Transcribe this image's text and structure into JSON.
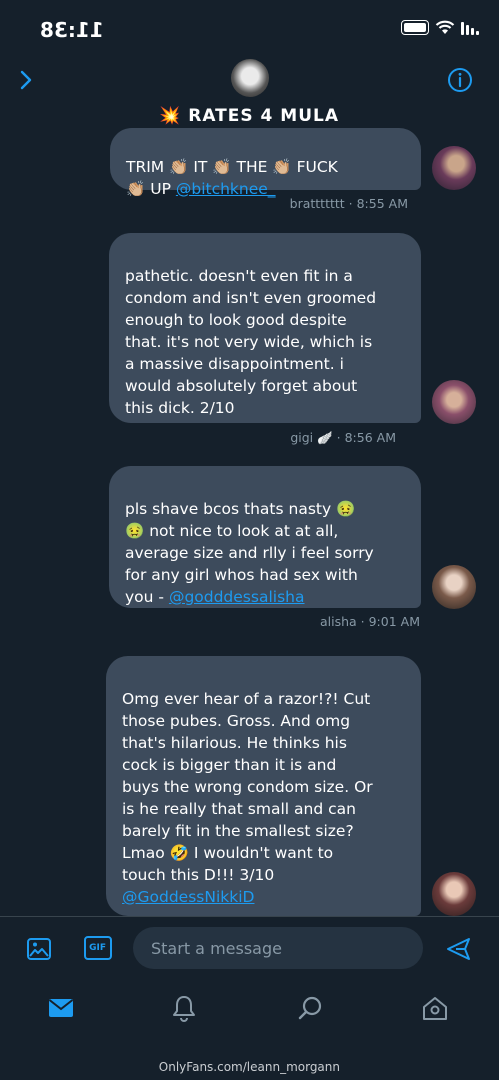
{
  "status_bar": {
    "time": "11:38"
  },
  "header": {
    "title": "💥 RATES 4 MULA"
  },
  "messages": [
    {
      "text_lines": [
        "TRIM 👏🏼 IT 👏🏼 THE 👏🏼 FUCK",
        "👏🏼 UP "
      ],
      "handle": "@bitchknee_",
      "sender": "brattttttt",
      "time": "8:55 AM"
    },
    {
      "text_lines": [
        "pathetic. doesn't even fit in a",
        "condom and isn't even groomed",
        "enough to look good despite",
        "that. it's not very wide, which is",
        "a massive disappointment. i",
        "would absolutely forget about",
        "this dick. 2/10"
      ],
      "sender": "gigi 🪽",
      "time": "8:56 AM"
    },
    {
      "text_lines": [
        "pls shave bcos thats nasty 🤢",
        "🤢 not nice to look at at all,",
        "average size and rlly i feel sorry",
        "for any girl whos had sex with",
        "you - "
      ],
      "handle": "@godddessalisha",
      "sender": "alisha",
      "time": "9:01 AM"
    },
    {
      "text_lines": [
        "Omg ever hear of a razor!?! Cut",
        "those pubes. Gross. And omg",
        "that's hilarious. He thinks his",
        "cock is bigger than it is and",
        "buys the wrong condom size. Or",
        "is he really that small and can",
        "barely fit in the smallest size?",
        "Lmao 🤣 I wouldn't want to",
        "touch this D!!! 3/10"
      ],
      "handle": "@GoddessNikkiD"
    }
  ],
  "composer": {
    "placeholder": "Start a message",
    "gif_label": "GIF"
  },
  "tabs": [
    "mail",
    "bell",
    "search",
    "home"
  ],
  "footer": {
    "watermark": "OnlyFans.com/leann_morgann"
  },
  "colors": {
    "background": "#15202b",
    "bubble": "#3d4b5c",
    "accent": "#1d9bf0",
    "meta": "#8899a6"
  },
  "icons": [
    "info-icon",
    "chevron-left-icon",
    "send-icon",
    "gif-icon",
    "image-icon",
    "mail-icon",
    "bell-icon",
    "search-icon",
    "home-icon"
  ]
}
